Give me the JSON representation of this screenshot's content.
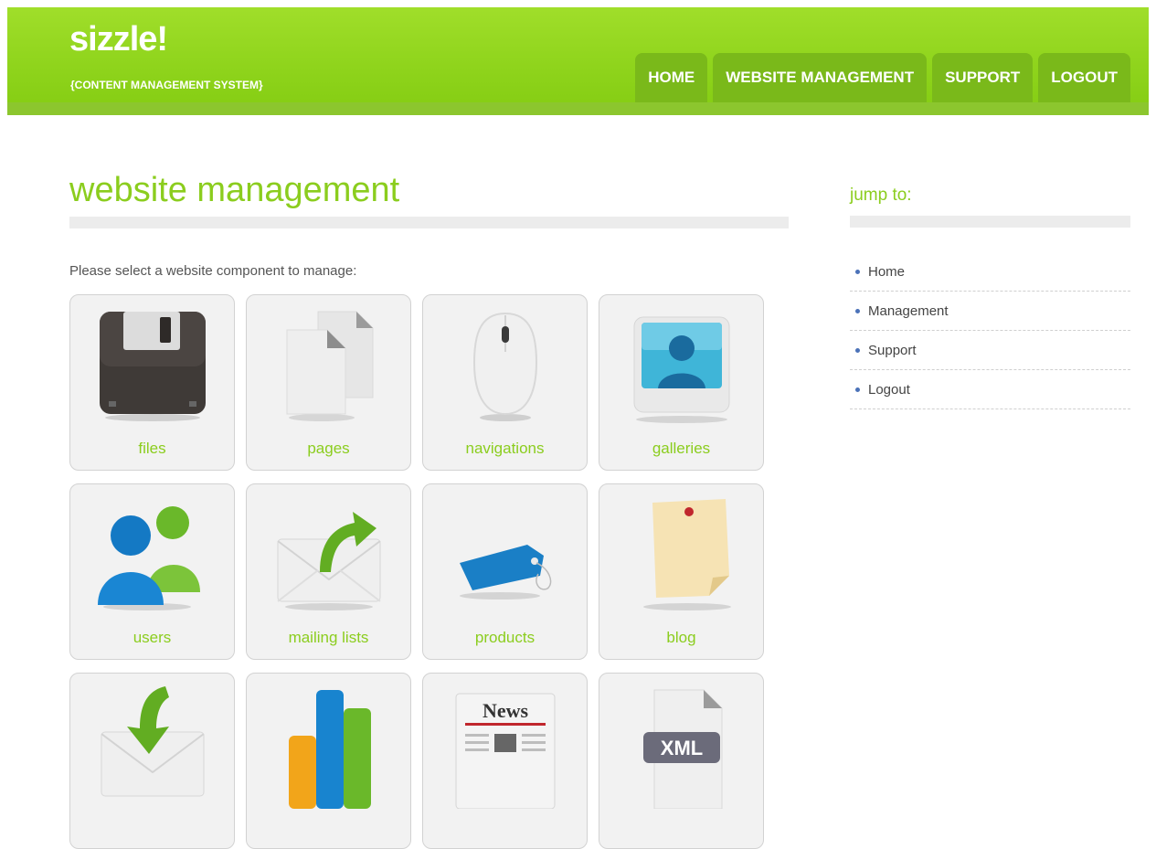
{
  "brand": {
    "logo": "sizzle!",
    "tagline": "{CONTENT MANAGEMENT SYSTEM}"
  },
  "nav": {
    "items": [
      "HOME",
      "WEBSITE MANAGEMENT",
      "SUPPORT",
      "LOGOUT"
    ]
  },
  "main": {
    "title": "website management",
    "intro": "Please select a website component to manage:",
    "tiles": [
      {
        "label": "files",
        "icon": "floppy-disk-icon"
      },
      {
        "label": "pages",
        "icon": "pages-icon"
      },
      {
        "label": "navigations",
        "icon": "mouse-icon"
      },
      {
        "label": "galleries",
        "icon": "picture-frame-icon"
      },
      {
        "label": "users",
        "icon": "users-icon"
      },
      {
        "label": "mailing lists",
        "icon": "envelope-send-icon"
      },
      {
        "label": "products",
        "icon": "price-tag-icon"
      },
      {
        "label": "blog",
        "icon": "sticky-note-icon"
      },
      {
        "label": "",
        "icon": "envelope-receive-icon"
      },
      {
        "label": "",
        "icon": "bar-chart-icon"
      },
      {
        "label": "",
        "icon": "newspaper-icon",
        "icon_text": "News"
      },
      {
        "label": "",
        "icon": "xml-file-icon",
        "icon_text": "XML"
      }
    ]
  },
  "sidebar": {
    "title": "jump to:",
    "items": [
      "Home",
      "Management",
      "Support",
      "Logout"
    ]
  },
  "colors": {
    "brand_green": "#8bcd1e",
    "nav_tab": "#7ab91a",
    "bullet": "#4b72b8"
  }
}
